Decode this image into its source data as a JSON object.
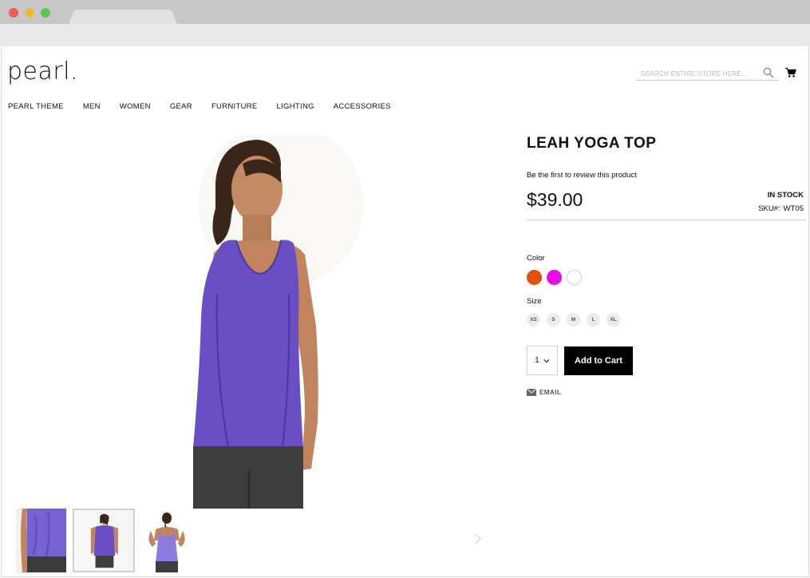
{
  "brand": {
    "logo": "pearl."
  },
  "search": {
    "placeholder": "SEARCH ENTIRE STORE HERE..."
  },
  "nav": [
    {
      "label": "PEARL THEME"
    },
    {
      "label": "MEN"
    },
    {
      "label": "WOMEN"
    },
    {
      "label": "GEAR"
    },
    {
      "label": "FURNITURE"
    },
    {
      "label": "LIGHTING"
    },
    {
      "label": "ACCESSORIES"
    }
  ],
  "product": {
    "title": "LEAH YOGA TOP",
    "review_link": "Be the first to review this product",
    "price": "$39.00",
    "stock": "IN STOCK",
    "sku_label": "SKU#:",
    "sku_value": "WT05",
    "color_label": "Color",
    "colors": [
      "#e25110",
      "#e60be8",
      "#ffffff"
    ],
    "size_label": "Size",
    "sizes": [
      "XS",
      "S",
      "M",
      "L",
      "XL"
    ],
    "qty": "1",
    "add_to_cart": "Add to Cart",
    "email_label": "EMAIL"
  },
  "icons": {
    "search": "search-icon",
    "cart": "cart-icon",
    "email": "envelope-icon",
    "chevron": "chevron-down-icon",
    "next": "chevron-right-icon"
  },
  "colors": {
    "top_purple": "#6a4fc4",
    "accent_black": "#000000"
  }
}
